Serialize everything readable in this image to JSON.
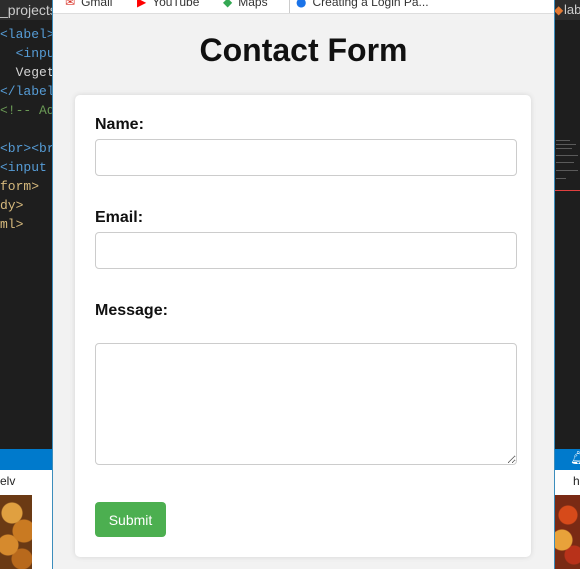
{
  "left_editor": {
    "tab_label": "_projects",
    "code_lines": [
      {
        "tag": "<label",
        "rest": ">"
      },
      {
        "indent": "  ",
        "tag": "<inpu",
        "rest": ""
      },
      {
        "indent": "  ",
        "text": "Veget"
      },
      {
        "tag": "</label",
        "rest": ""
      },
      {
        "comment": "<!-- Ad"
      },
      {
        "tag": "<br><br",
        "rest": ""
      },
      {
        "tag": "<input",
        "rest": ""
      },
      {
        "text_amber": "form>"
      },
      {
        "text_amber": "dy>"
      },
      {
        "text_amber": "ml>"
      }
    ],
    "bottom_text": "elv"
  },
  "right_editor": {
    "tab_label": "lab",
    "bottom_text": "h"
  },
  "bookmarks": [
    {
      "icon": "gmail-icon",
      "label": "Gmail"
    },
    {
      "icon": "youtube-icon",
      "label": "YouTube"
    },
    {
      "icon": "maps-icon",
      "label": "Maps"
    },
    {
      "icon": "info-icon",
      "label": "Creating a Login Pa..."
    }
  ],
  "page": {
    "title": "Contact Form",
    "form": {
      "name_label": "Name:",
      "name_value": "",
      "email_label": "Email:",
      "email_value": "",
      "message_label": "Message:",
      "message_value": "",
      "submit_label": "Submit"
    }
  },
  "colors": {
    "submit_button": "#4caf50",
    "page_background": "#f2f2f2",
    "card_background": "#ffffff",
    "status_bar": "#007acc"
  }
}
